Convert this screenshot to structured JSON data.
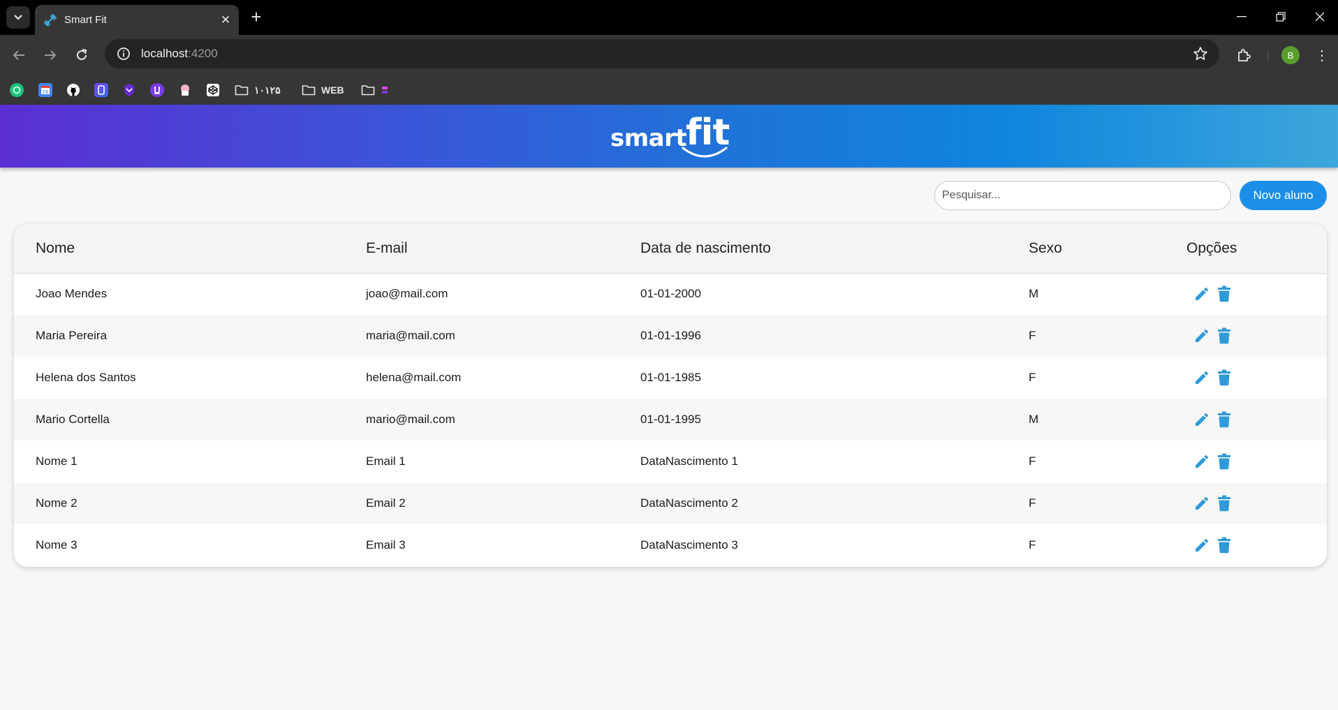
{
  "browser": {
    "tab_title": "Smart Fit",
    "url_host": "localhost",
    "url_port": ":4200",
    "profile_initial": "B",
    "bookmarks": [
      {
        "icon": "chatgpt-icon",
        "label": ""
      },
      {
        "icon": "calendar-icon",
        "label": ""
      },
      {
        "icon": "github-icon",
        "label": ""
      },
      {
        "icon": "app-icon",
        "label": ""
      },
      {
        "icon": "shield-icon",
        "label": ""
      },
      {
        "icon": "extension-icon",
        "label": ""
      },
      {
        "icon": "cupcake-icon",
        "label": ""
      },
      {
        "icon": "codepen-icon",
        "label": ""
      },
      {
        "icon": "folder-icon",
        "label": "۱۰۱۲۵"
      },
      {
        "icon": "folder-icon",
        "label": "WEB"
      },
      {
        "icon": "folder-icon",
        "label": ""
      }
    ]
  },
  "app": {
    "logo_smart": "smart",
    "logo_fit": "fit",
    "search_placeholder": "Pesquisar...",
    "new_button": "Novo aluno",
    "columns": [
      "Nome",
      "E-mail",
      "Data de nascimento",
      "Sexo",
      "Opções"
    ],
    "rows": [
      {
        "nome": "Joao Mendes",
        "email": "joao@mail.com",
        "nascimento": "01-01-2000",
        "sexo": "M"
      },
      {
        "nome": "Maria Pereira",
        "email": "maria@mail.com",
        "nascimento": "01-01-1996",
        "sexo": "F"
      },
      {
        "nome": "Helena dos Santos",
        "email": "helena@mail.com",
        "nascimento": "01-01-1985",
        "sexo": "F"
      },
      {
        "nome": "Mario Cortella",
        "email": "mario@mail.com",
        "nascimento": "01-01-1995",
        "sexo": "M"
      },
      {
        "nome": "Nome 1",
        "email": "Email 1",
        "nascimento": "DataNascimento 1",
        "sexo": "F"
      },
      {
        "nome": "Nome 2",
        "email": "Email 2",
        "nascimento": "DataNascimento 2",
        "sexo": "F"
      },
      {
        "nome": "Nome 3",
        "email": "Email 3",
        "nascimento": "DataNascimento 3",
        "sexo": "F"
      }
    ]
  },
  "colors": {
    "accent": "#1c8ee8",
    "icon_blue": "#2f9ad8",
    "header_gradient_start": "#5b2fd3",
    "header_gradient_end": "#3da6db"
  }
}
